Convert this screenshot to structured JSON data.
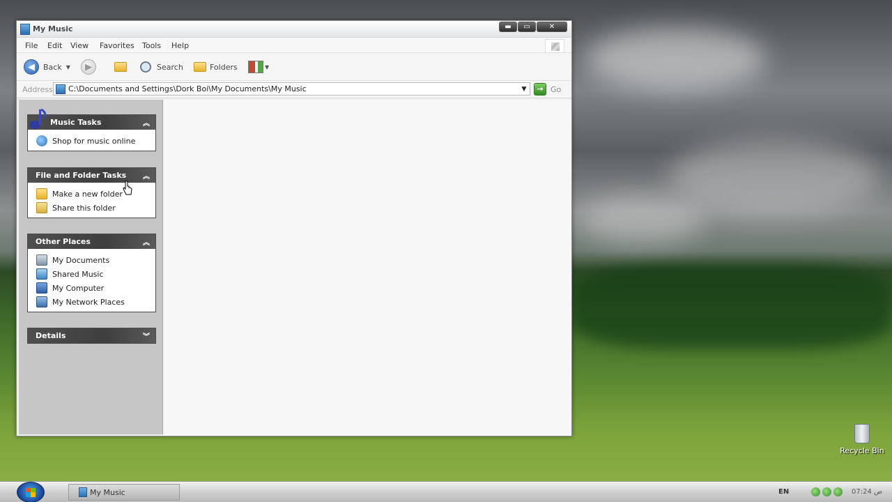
{
  "window": {
    "title": "My Music",
    "buttons": {
      "minimize": "▬",
      "maximize": "▭",
      "close": "✕"
    }
  },
  "menu": {
    "items": [
      {
        "label": "File"
      },
      {
        "label": "Edit"
      },
      {
        "label": "View"
      },
      {
        "label": "Favorites"
      },
      {
        "label": "Tools"
      },
      {
        "label": "Help"
      }
    ]
  },
  "toolbar": {
    "back_label": "Back",
    "search_label": "Search",
    "folders_label": "Folders"
  },
  "address": {
    "label": "Address",
    "path": "C:\\Documents and Settings\\Dork Boi\\My Documents\\My Music",
    "go_label": "Go"
  },
  "taskpane": {
    "music_tasks": {
      "title": "Music Tasks",
      "links": [
        {
          "label": "Shop for music online",
          "icon": "globe-icon"
        }
      ]
    },
    "file_folder_tasks": {
      "title": "File and Folder Tasks",
      "links": [
        {
          "label": "Make a new folder",
          "icon": "new-folder-icon"
        },
        {
          "label": "Share this folder",
          "icon": "share-folder-icon"
        }
      ]
    },
    "other_places": {
      "title": "Other Places",
      "links": [
        {
          "label": "My Documents",
          "icon": "my-documents-icon"
        },
        {
          "label": "Shared Music",
          "icon": "shared-music-icon"
        },
        {
          "label": "My Computer",
          "icon": "my-computer-icon"
        },
        {
          "label": "My Network Places",
          "icon": "network-places-icon"
        }
      ]
    },
    "details": {
      "title": "Details"
    }
  },
  "desktop": {
    "recycle_bin": "Recycle Bin"
  },
  "taskbar": {
    "task_item": "My Music",
    "language": "EN",
    "clock": "07:24 ص"
  }
}
